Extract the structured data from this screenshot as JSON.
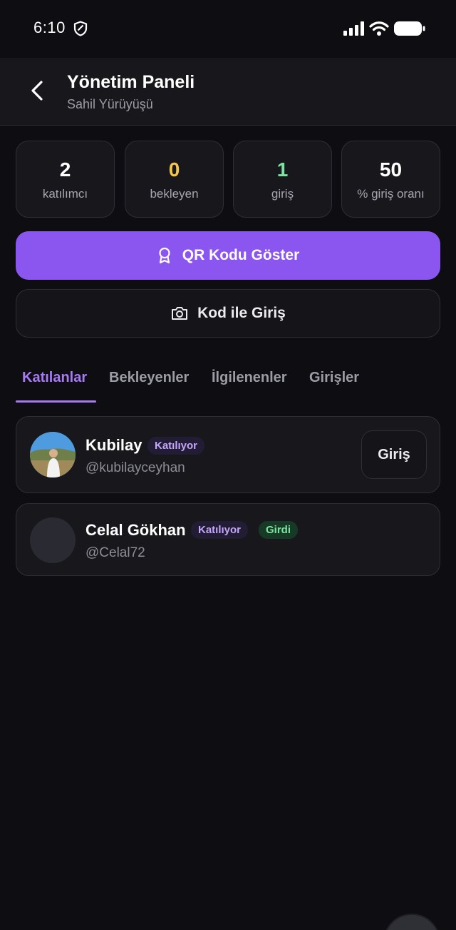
{
  "status_bar": {
    "time": "6:10"
  },
  "header": {
    "title": "Yönetim Paneli",
    "subtitle": "Sahil Yürüyüşü"
  },
  "stats": [
    {
      "value": "2",
      "label": "katılımcı",
      "color": "#ffffff"
    },
    {
      "value": "0",
      "label": "bekleyen",
      "color": "#f5c64a"
    },
    {
      "value": "1",
      "label": "giriş",
      "color": "#7ce3a0"
    },
    {
      "value": "50",
      "label": "% giriş oranı",
      "color": "#ffffff"
    }
  ],
  "actions": {
    "qr_label": "QR Kodu Göster",
    "code_label": "Kod ile Giriş"
  },
  "tabs": [
    {
      "label": "Katılanlar",
      "active": true
    },
    {
      "label": "Bekleyenler",
      "active": false
    },
    {
      "label": "İlgilenenler",
      "active": false
    },
    {
      "label": "Girişler",
      "active": false
    }
  ],
  "participants": [
    {
      "name": "Kubilay",
      "handle": "@kubilayceyhan",
      "status_badge": "Katılıyor",
      "action_label": "Giriş"
    },
    {
      "name": "Celal Gökhan",
      "handle": "@Celal72",
      "status_badge": "Katılıyor",
      "checkin_badge": "Girdi"
    }
  ],
  "colors": {
    "accent": "#8b55f0",
    "tab_active": "#a77af5",
    "background": "#0e0e12",
    "card": "#17171c"
  }
}
